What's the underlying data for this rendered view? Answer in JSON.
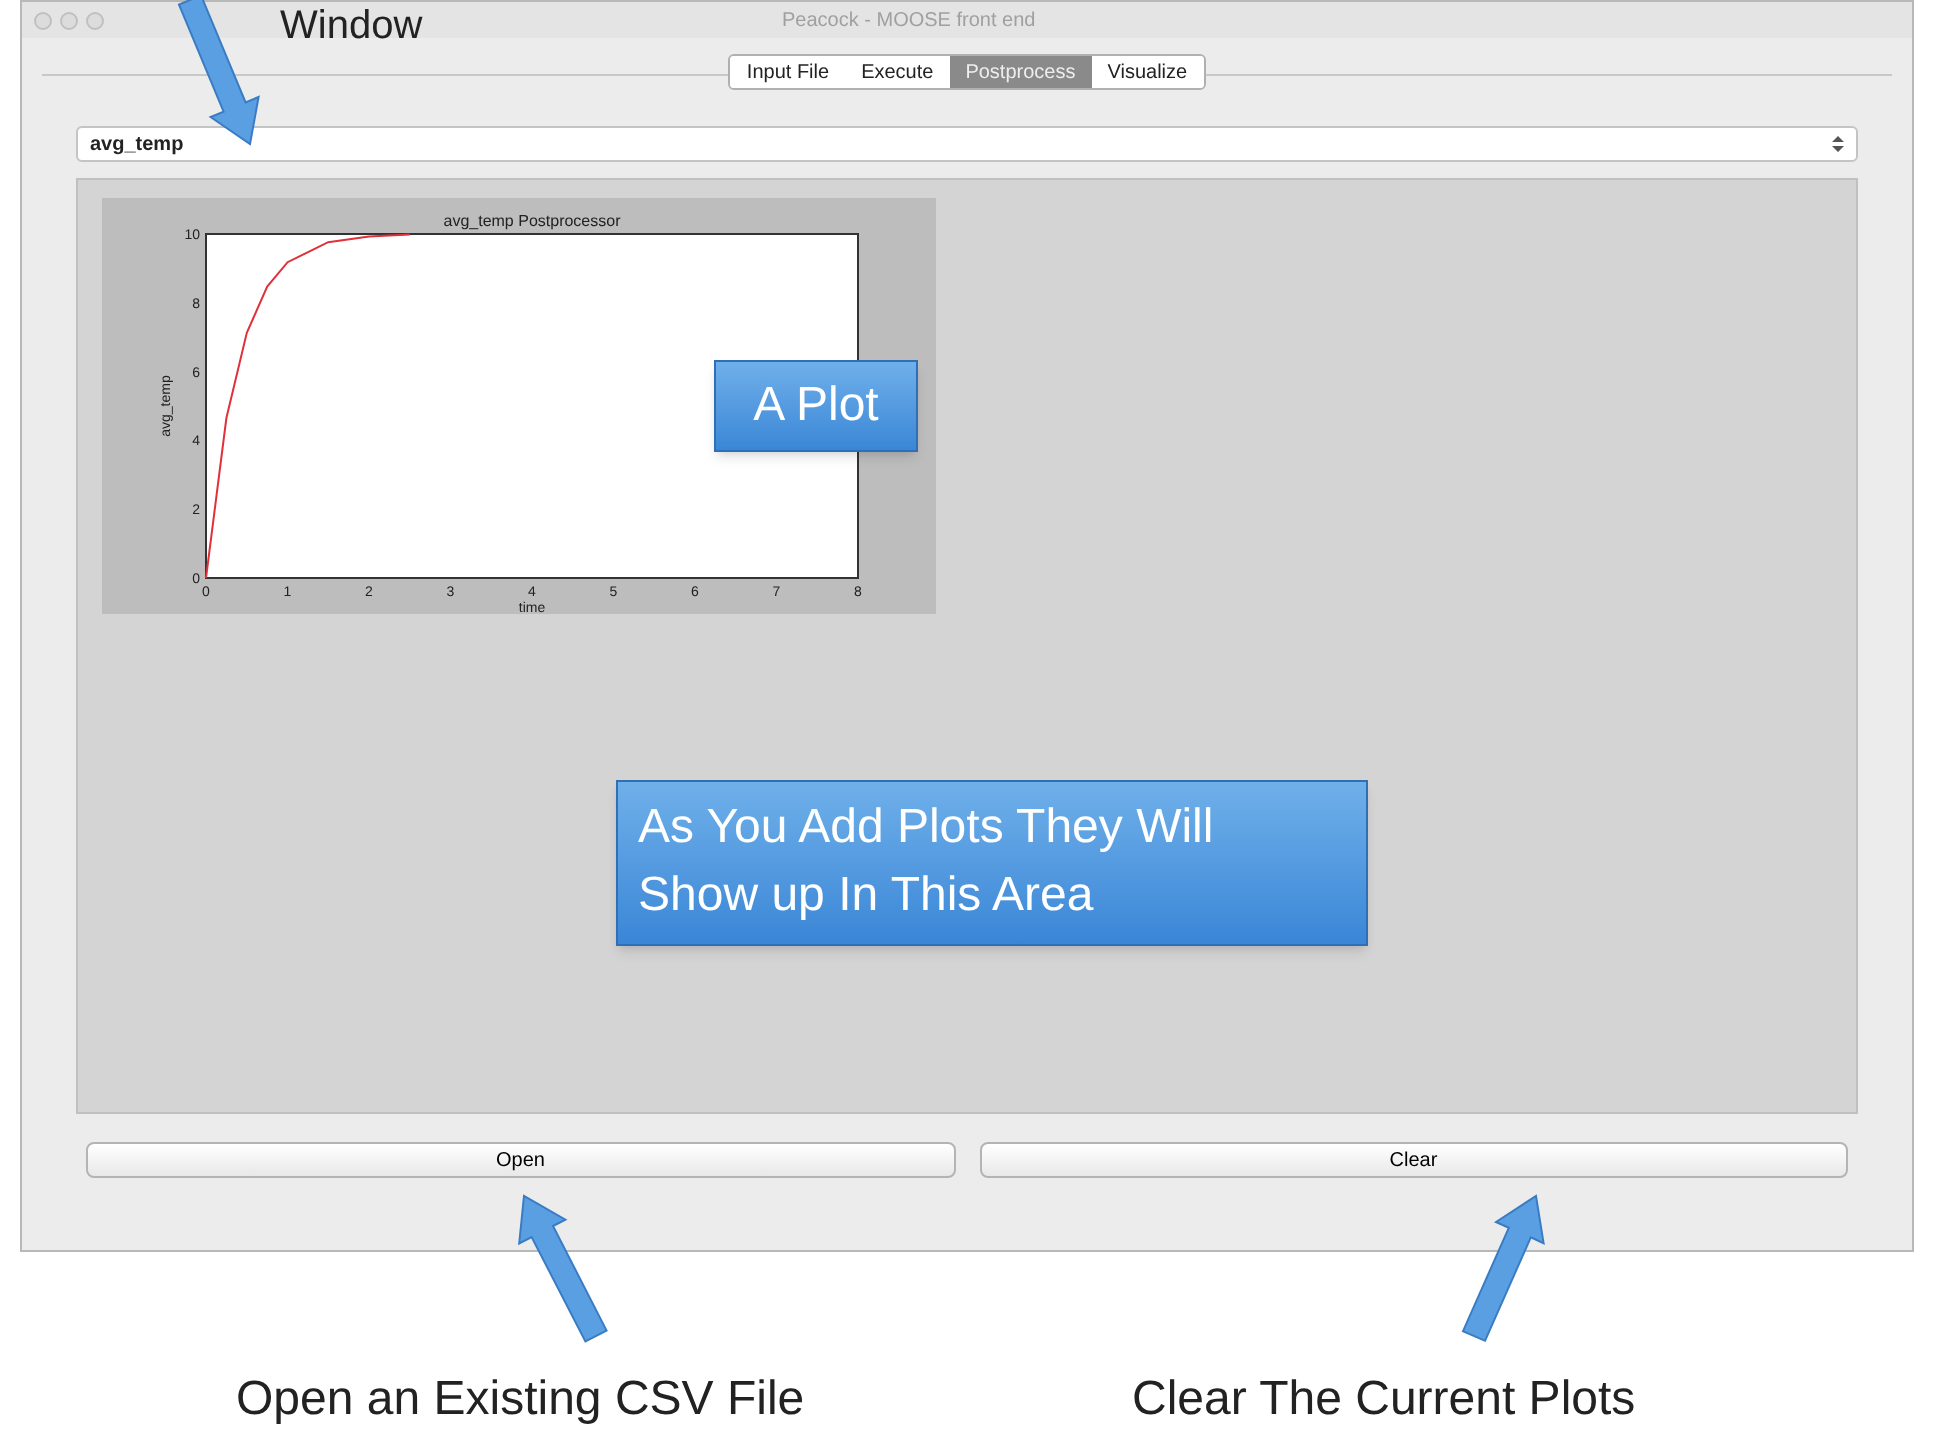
{
  "window": {
    "title": "Peacock - MOOSE front end"
  },
  "tabs": [
    {
      "label": "Input File",
      "selected": false
    },
    {
      "label": "Execute",
      "selected": false
    },
    {
      "label": "Postprocess",
      "selected": true
    },
    {
      "label": "Visualize",
      "selected": false
    }
  ],
  "postprocessor_select": {
    "value": "avg_temp"
  },
  "plot": {
    "chart_data": {
      "type": "line",
      "title": "avg_temp Postprocessor",
      "xlabel": "time",
      "ylabel": "avg_temp",
      "x": [
        0,
        0.25,
        0.5,
        0.75,
        1,
        1.5,
        2,
        2.5
      ],
      "series": [
        {
          "color": "#e0303a",
          "values": [
            0,
            4.65,
            7.13,
            8.47,
            9.18,
            9.76,
            9.93,
            9.98
          ]
        }
      ],
      "xlim": [
        0,
        8
      ],
      "ylim": [
        0,
        10
      ],
      "xticks": [
        0,
        1,
        2,
        3,
        4,
        5,
        6,
        7,
        8
      ],
      "yticks": [
        0,
        2,
        4,
        6,
        8,
        10
      ]
    }
  },
  "buttons": [
    {
      "label": "Open"
    },
    {
      "label": "Clear"
    }
  ],
  "annotations": [
    {
      "kind": "caption",
      "text": "Window"
    },
    {
      "kind": "callout",
      "text": "A Plot"
    },
    {
      "kind": "callout",
      "text": "As You Add Plots They Will Show up In This Area"
    },
    {
      "kind": "caption",
      "text": "Open an Existing CSV File"
    },
    {
      "kind": "caption",
      "text": "Clear The Current Plots"
    }
  ]
}
